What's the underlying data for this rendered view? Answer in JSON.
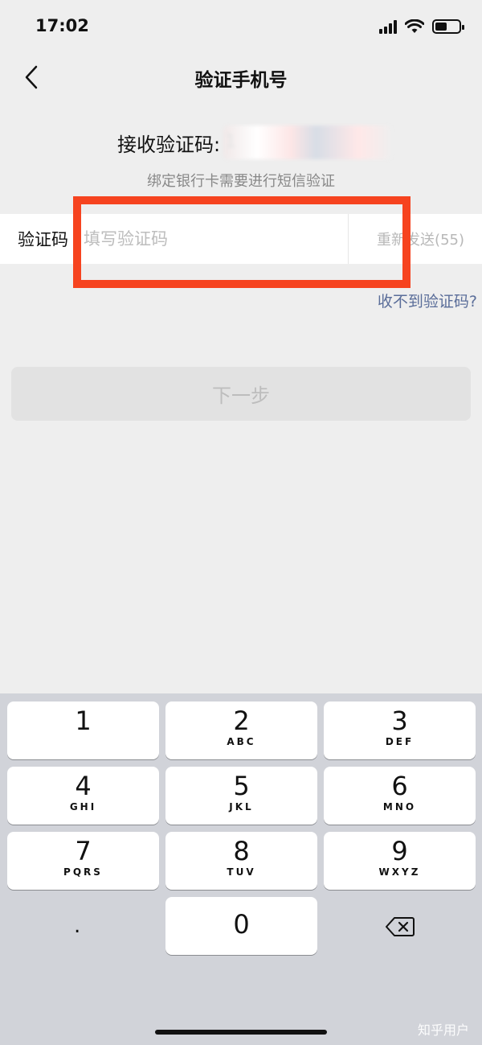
{
  "status_bar": {
    "time": "17:02"
  },
  "nav": {
    "title": "验证手机号"
  },
  "receive": {
    "label": "接收验证码:",
    "phone": "1"
  },
  "hint": "绑定银行卡需要进行短信验证",
  "code_field": {
    "label": "验证码",
    "placeholder": "填写验证码",
    "value": "",
    "resend": "重新发送(55)"
  },
  "no_code_link": "收不到验证码?",
  "next_button": "下一步",
  "highlight_color": "#f6431f",
  "keypad": {
    "keys": [
      {
        "num": "1",
        "letters": ""
      },
      {
        "num": "2",
        "letters": "ABC"
      },
      {
        "num": "3",
        "letters": "DEF"
      },
      {
        "num": "4",
        "letters": "GHI"
      },
      {
        "num": "5",
        "letters": "JKL"
      },
      {
        "num": "6",
        "letters": "MNO"
      },
      {
        "num": "7",
        "letters": "PQRS"
      },
      {
        "num": "8",
        "letters": "TUV"
      },
      {
        "num": "9",
        "letters": "WXYZ"
      },
      {
        "num": "0",
        "letters": ""
      }
    ],
    "dot": ".",
    "delete_icon": "backspace-icon"
  },
  "watermark": "知乎用户"
}
